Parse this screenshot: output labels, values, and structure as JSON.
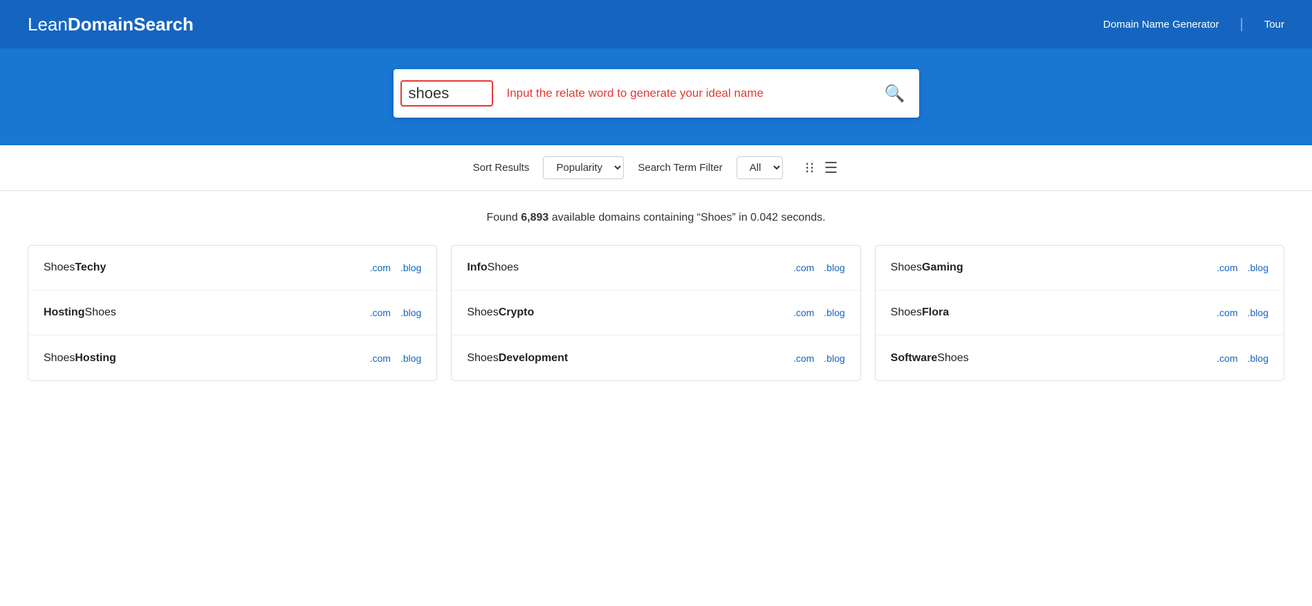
{
  "header": {
    "logo_light": "Lean",
    "logo_bold": "DomainSearch",
    "nav": {
      "generator_label": "Domain Name Generator",
      "tour_label": "Tour"
    }
  },
  "search": {
    "input_value": "shoes",
    "hint_text": "Input the relate word to generate your ideal name",
    "button_icon": "🔍"
  },
  "controls": {
    "sort_label": "Sort Results",
    "sort_value": "Popularity",
    "filter_label": "Search Term Filter",
    "filter_value": "All"
  },
  "results": {
    "summary_pre": "Found ",
    "count": "6,893",
    "summary_mid": " available domains",
    "summary_post": " containing “Shoes” in 0.042 seconds."
  },
  "domains": [
    {
      "column": 0,
      "rows": [
        {
          "prefix": "Shoes",
          "suffix": "Techy",
          "prefix_bold": false,
          "suffix_bold": true
        },
        {
          "prefix": "Hosting",
          "suffix": "Shoes",
          "prefix_bold": true,
          "suffix_bold": false
        },
        {
          "prefix": "Shoes",
          "suffix": "Hosting",
          "prefix_bold": false,
          "suffix_bold": true
        }
      ]
    },
    {
      "column": 1,
      "rows": [
        {
          "prefix": "Info",
          "suffix": "Shoes",
          "prefix_bold": false,
          "suffix_bold": false,
          "prefix_bold_val": true,
          "mid_word": false
        },
        {
          "prefix": "Shoes",
          "suffix": "Crypto",
          "prefix_bold": false,
          "suffix_bold": true
        },
        {
          "prefix": "Shoes",
          "suffix": "Development",
          "prefix_bold": false,
          "suffix_bold": true
        }
      ]
    },
    {
      "column": 2,
      "rows": [
        {
          "prefix": "Shoes",
          "suffix": "Gaming",
          "prefix_bold": false,
          "suffix_bold": true
        },
        {
          "prefix": "Shoes",
          "suffix": "Flora",
          "prefix_bold": false,
          "suffix_bold": true
        },
        {
          "prefix": "Software",
          "suffix": "Shoes",
          "prefix_bold": true,
          "suffix_bold": false
        }
      ]
    }
  ],
  "domain_ext": {
    "com": ".com",
    "blog": ".blog"
  }
}
